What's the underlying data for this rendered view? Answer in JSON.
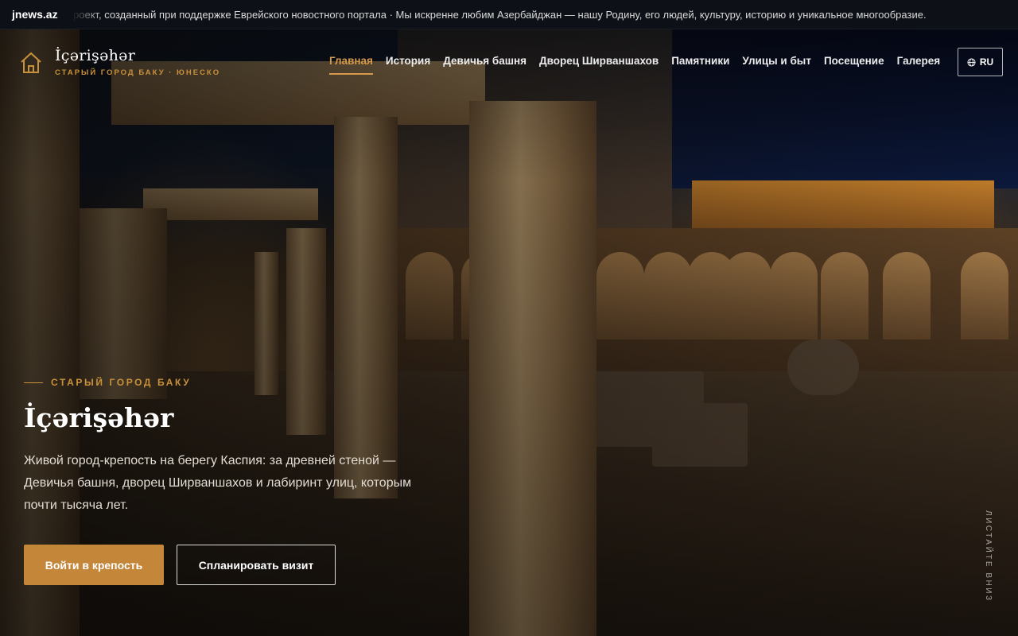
{
  "topbar": {
    "brand": "jnews.az",
    "ticker": "роект, созданный при поддержке Еврейского новостного портала · Мы искренне любим Азербайджан — нашу Родину, его людей, культуру, историю и уникальное многообразие."
  },
  "header": {
    "logo_icon": "house-icon",
    "logo_title": "İçərişəhər",
    "logo_subtitle": "СТАРЫЙ ГОРОД БАКУ · ЮНЕСКО",
    "nav": [
      {
        "label": "Главная",
        "active": true
      },
      {
        "label": "История",
        "active": false
      },
      {
        "label": "Девичья башня",
        "active": false
      },
      {
        "label": "Дворец Ширваншахов",
        "active": false
      },
      {
        "label": "Памятники",
        "active": false
      },
      {
        "label": "Улицы и быт",
        "active": false
      },
      {
        "label": "Посещение",
        "active": false
      },
      {
        "label": "Галерея",
        "active": false
      }
    ],
    "language": {
      "icon": "globe-icon",
      "label": "RU"
    }
  },
  "hero": {
    "eyebrow": "СТАРЫЙ ГОРОД БАКУ",
    "title": "İçərişəhər",
    "description": "Живой город-крепость на берегу Каспия: за древней стеной — Девичья башня, дворец Ширваншахов и лабиринт улиц, которым почти тысяча лет.",
    "primary_button": "Войти в крепость",
    "secondary_button": "Спланировать визит",
    "scroll_hint": "ЛИСТАЙТЕ ВНИЗ"
  },
  "colors": {
    "accent": "#c4873a",
    "accent_text": "#d59a4a",
    "topbar_bg": "#0d1117"
  }
}
